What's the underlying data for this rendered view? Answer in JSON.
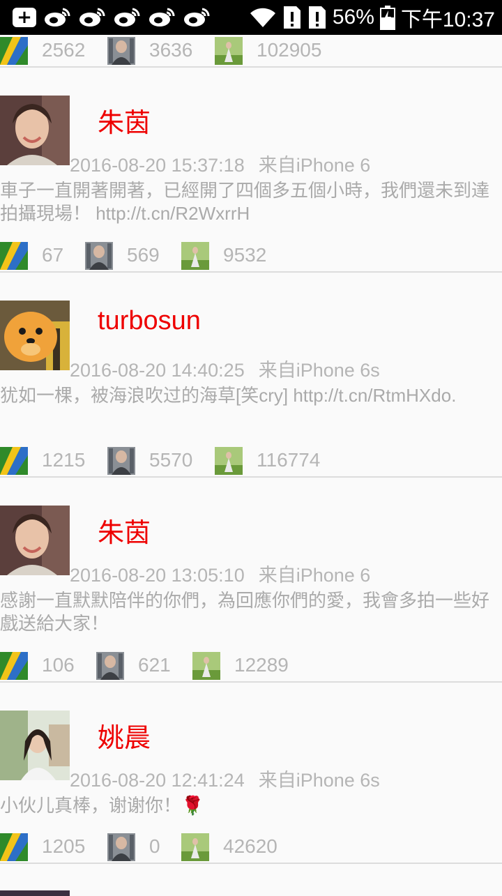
{
  "status_bar": {
    "icons": [
      "plus-square-icon",
      "weibo-icon",
      "weibo-icon",
      "weibo-icon",
      "weibo-icon",
      "weibo-icon",
      "wifi-icon",
      "sim-alert-icon",
      "sim-alert-icon",
      "battery-charging-icon"
    ],
    "battery": "56%",
    "time": "下午10:37"
  },
  "top_stats": {
    "reposts": "2562",
    "comments": "3636",
    "likes": "102905"
  },
  "posts": [
    {
      "name": "朱茵",
      "time": "2016-08-20 15:37:18",
      "source": "来自iPhone 6",
      "content": "車子一直開著開著，已經開了四個多五個小時，我們還未到達拍攝現場！ http://t.cn/R2WxrrH",
      "reposts": "67",
      "comments": "569",
      "likes": "9532"
    },
    {
      "name": "turbosun",
      "time": "2016-08-20 14:40:25",
      "source": "来自iPhone 6s",
      "content": "犹如一棵，被海浪吹过的海草[笑cry] http://t.cn/RtmHXdo.",
      "reposts": "1215",
      "comments": "5570",
      "likes": "116774"
    },
    {
      "name": "朱茵",
      "time": "2016-08-20 13:05:10",
      "source": "来自iPhone 6",
      "content": "感謝一直默默陪伴的你們，為回應你們的愛，我會多拍一些好戲送給大家！",
      "reposts": "106",
      "comments": "621",
      "likes": "12289"
    },
    {
      "name": "姚晨",
      "time": "2016-08-20 12:41:24",
      "source": "来自iPhone 6s",
      "content": "小伙儿真棒，谢谢你！🌹",
      "reposts": "1205",
      "comments": "0",
      "likes": "42620"
    }
  ]
}
